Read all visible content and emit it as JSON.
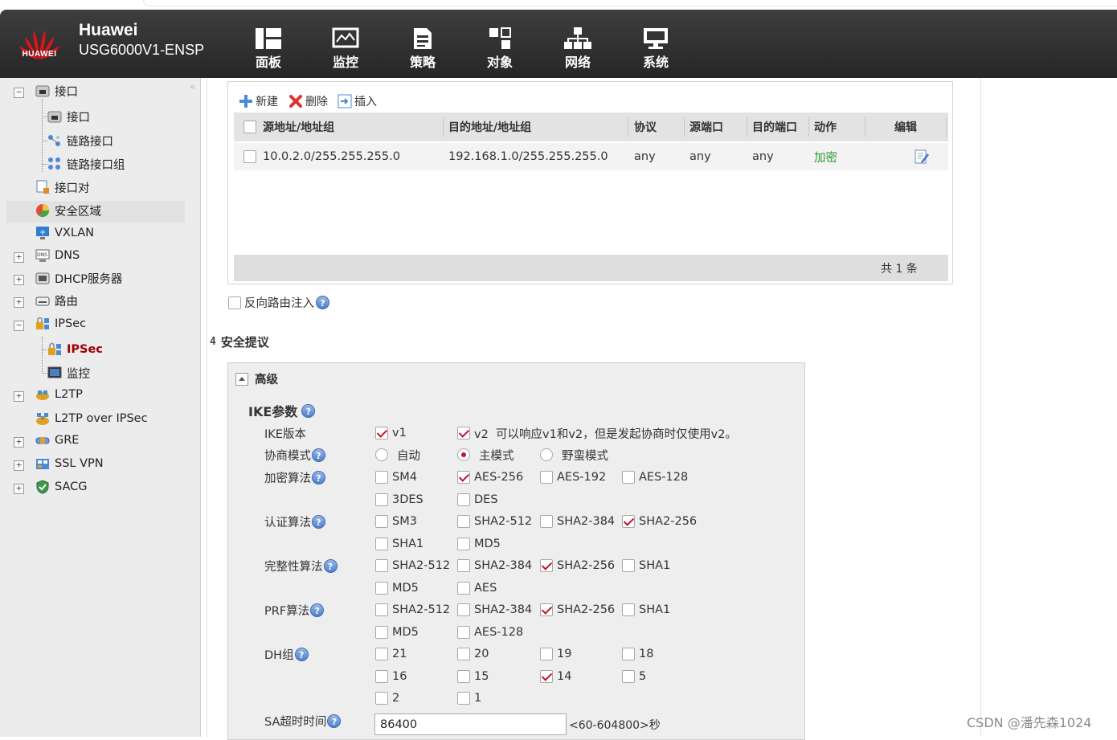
{
  "header": {
    "logo_text": "HUAWEI",
    "brand_line1": "Huawei",
    "brand_line2": "USG6000V1-ENSP",
    "nav": [
      {
        "label": "面板",
        "icon": "dashboard-icon"
      },
      {
        "label": "监控",
        "icon": "monitor-icon"
      },
      {
        "label": "策略",
        "icon": "policy-icon"
      },
      {
        "label": "对象",
        "icon": "object-icon"
      },
      {
        "label": "网络",
        "icon": "network-icon"
      },
      {
        "label": "系统",
        "icon": "system-icon"
      }
    ]
  },
  "sidebar": {
    "collapse": "«",
    "items": [
      {
        "label": "接口",
        "expander": "−"
      },
      {
        "label": "接口"
      },
      {
        "label": "链路接口"
      },
      {
        "label": "链路接口组"
      },
      {
        "label": "接口对"
      },
      {
        "label": "安全区域"
      },
      {
        "label": "VXLAN"
      },
      {
        "label": "DNS",
        "expander": "+"
      },
      {
        "label": "DHCP服务器",
        "expander": "+"
      },
      {
        "label": "路由",
        "expander": "+"
      },
      {
        "label": "IPSec",
        "expander": "−"
      },
      {
        "label": "IPSec",
        "selected": true
      },
      {
        "label": "监控"
      },
      {
        "label": "L2TP",
        "expander": "+"
      },
      {
        "label": "L2TP over IPSec"
      },
      {
        "label": "GRE",
        "expander": "+"
      },
      {
        "label": "SSL VPN",
        "expander": "+"
      },
      {
        "label": "SACG",
        "expander": "+"
      }
    ]
  },
  "rules": {
    "toolbar": {
      "new": "新建",
      "delete": "删除",
      "insert": "插入"
    },
    "columns": [
      "源地址/地址组",
      "目的地址/地址组",
      "协议",
      "源端口",
      "目的端口",
      "动作",
      "编辑"
    ],
    "rows": [
      {
        "src": "10.0.2.0/255.255.255.0",
        "dst": "192.168.1.0/255.255.255.0",
        "proto": "any",
        "sport": "any",
        "dport": "any",
        "action": "加密"
      }
    ],
    "footer": "共 1 条"
  },
  "reverse_route": {
    "label": "反向路由注入",
    "checked": false
  },
  "section4": {
    "number": "4",
    "title": "安全提议"
  },
  "advanced": {
    "title": "高级",
    "ike_title": "IKE参数",
    "ike_version": {
      "label": "IKE版本",
      "options": [
        {
          "label": "v1",
          "checked": true
        },
        {
          "label": "v2  可以响应v1和v2，但是发起协商时仅使用v2。",
          "checked": true
        }
      ]
    },
    "nego_mode": {
      "label": "协商模式",
      "options": [
        {
          "label": "自动",
          "checked": false
        },
        {
          "label": "主模式",
          "checked": true
        },
        {
          "label": "野蛮模式",
          "checked": false
        }
      ]
    },
    "encryption": {
      "label": "加密算法",
      "options": [
        {
          "label": "SM4",
          "checked": false
        },
        {
          "label": "AES-256",
          "checked": true
        },
        {
          "label": "AES-192",
          "checked": false
        },
        {
          "label": "AES-128",
          "checked": false
        },
        {
          "label": "3DES",
          "checked": false
        },
        {
          "label": "DES",
          "checked": false
        }
      ]
    },
    "auth": {
      "label": "认证算法",
      "options": [
        {
          "label": "SM3",
          "checked": false
        },
        {
          "label": "SHA2-512",
          "checked": false
        },
        {
          "label": "SHA2-384",
          "checked": false
        },
        {
          "label": "SHA2-256",
          "checked": true
        },
        {
          "label": "SHA1",
          "checked": false
        },
        {
          "label": "MD5",
          "checked": false
        }
      ]
    },
    "integrity": {
      "label": "完整性算法",
      "options": [
        {
          "label": "SHA2-512",
          "checked": false
        },
        {
          "label": "SHA2-384",
          "checked": false
        },
        {
          "label": "SHA2-256",
          "checked": true
        },
        {
          "label": "SHA1",
          "checked": false
        },
        {
          "label": "MD5",
          "checked": false
        },
        {
          "label": "AES",
          "checked": false
        }
      ]
    },
    "prf": {
      "label": "PRF算法",
      "options": [
        {
          "label": "SHA2-512",
          "checked": false
        },
        {
          "label": "SHA2-384",
          "checked": false
        },
        {
          "label": "SHA2-256",
          "checked": true
        },
        {
          "label": "SHA1",
          "checked": false
        },
        {
          "label": "MD5",
          "checked": false
        },
        {
          "label": "AES-128",
          "checked": false
        }
      ]
    },
    "dh": {
      "label": "DH组",
      "options": [
        {
          "label": "21",
          "checked": false
        },
        {
          "label": "20",
          "checked": false
        },
        {
          "label": "19",
          "checked": false
        },
        {
          "label": "18",
          "checked": false
        },
        {
          "label": "16",
          "checked": false
        },
        {
          "label": "15",
          "checked": false
        },
        {
          "label": "14",
          "checked": true
        },
        {
          "label": "5",
          "checked": false
        },
        {
          "label": "2",
          "checked": false
        },
        {
          "label": "1",
          "checked": false
        }
      ]
    },
    "sa_timeout": {
      "label": "SA超时时间",
      "value": "86400",
      "range": "<60-604800>秒"
    }
  },
  "help_glyph": "?",
  "watermark": "CSDN @潘先森1024",
  "colors": {
    "header": "#2f2f2f",
    "check_accent": "#c0142b",
    "action_green": "#2e9a2e",
    "selected_text": "#a00000"
  }
}
